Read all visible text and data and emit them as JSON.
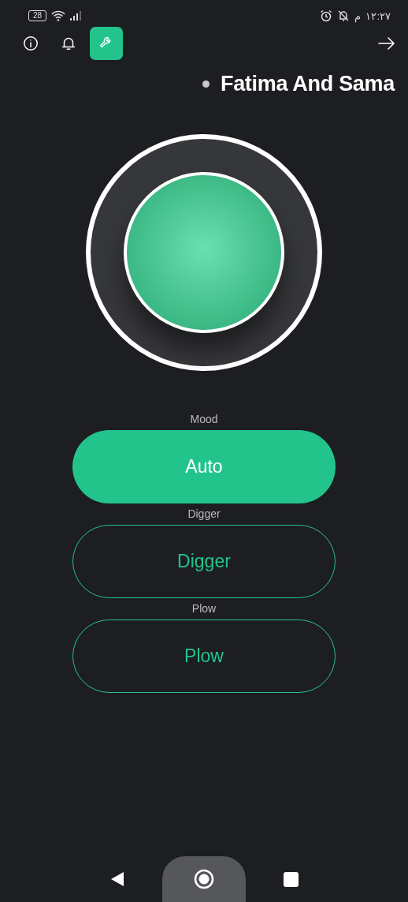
{
  "status_bar": {
    "battery": "28",
    "period": "م",
    "time": "١٢:٢٧"
  },
  "toolbar": {
    "tools": [
      {
        "kind": "info",
        "selected": false
      },
      {
        "kind": "bell",
        "selected": false
      },
      {
        "kind": "wrench",
        "selected": true
      }
    ]
  },
  "device": {
    "name": "Fatima And Sama",
    "online": false
  },
  "main_button": {
    "on": true
  },
  "controls": [
    {
      "label": "Mood",
      "button": "Auto",
      "on": true
    },
    {
      "label": "Digger",
      "button": "Digger",
      "on": false
    },
    {
      "label": "Plow",
      "button": "Plow",
      "on": false
    }
  ]
}
